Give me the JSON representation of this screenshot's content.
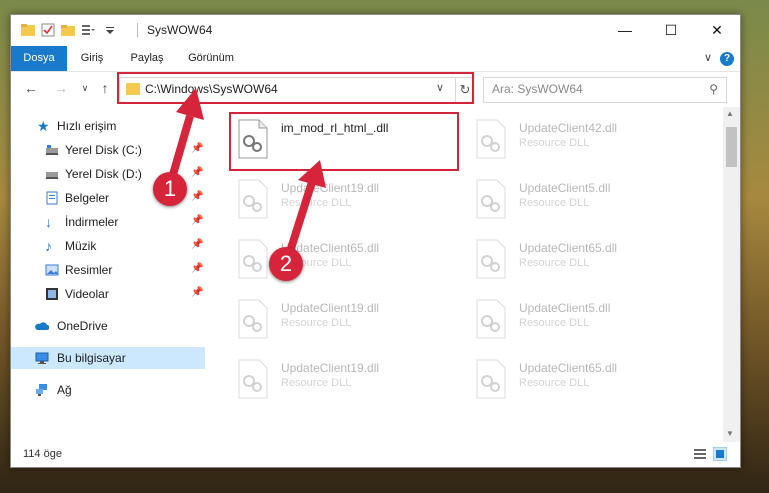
{
  "window": {
    "title": "SysWOW64"
  },
  "ribbon": {
    "tabs": [
      {
        "label": "Dosya",
        "active": true
      },
      {
        "label": "Giriş",
        "active": false
      },
      {
        "label": "Paylaş",
        "active": false
      },
      {
        "label": "Görünüm",
        "active": false
      }
    ],
    "help": "?"
  },
  "nav": {
    "address": "C:\\Windows\\SysWOW64",
    "search_placeholder": "Ara: SysWOW64"
  },
  "sidebar": {
    "items": [
      {
        "label": "Hızlı erişim",
        "icon": "star-icon",
        "pinned": false
      },
      {
        "label": "Yerel Disk (C:)",
        "icon": "drive-icon",
        "pinned": true
      },
      {
        "label": "Yerel Disk (D:)",
        "icon": "drive-icon",
        "pinned": true
      },
      {
        "label": "Belgeler",
        "icon": "documents-icon",
        "pinned": true
      },
      {
        "label": "İndirmeler",
        "icon": "download-icon",
        "pinned": true
      },
      {
        "label": "Müzik",
        "icon": "music-icon",
        "pinned": true
      },
      {
        "label": "Resimler",
        "icon": "pictures-icon",
        "pinned": true
      },
      {
        "label": "Videolar",
        "icon": "videos-icon",
        "pinned": true
      },
      {
        "label": "OneDrive",
        "icon": "cloud-icon",
        "pinned": false
      },
      {
        "label": "Bu bilgisayar",
        "icon": "computer-icon",
        "pinned": false,
        "selected": true
      },
      {
        "label": "Ağ",
        "icon": "network-icon",
        "pinned": false
      }
    ]
  },
  "files": [
    {
      "name": "im_mod_rl_html_.dll",
      "type": ""
    },
    {
      "name": "UpdateClient42.dll",
      "type": "Resource DLL"
    },
    {
      "name": "UpdateClient19.dll",
      "type": "Resource DLL"
    },
    {
      "name": "UpdateClient5.dll",
      "type": "Resource DLL"
    },
    {
      "name": "UpdateClient65.dll",
      "type": "Resource DLL"
    },
    {
      "name": "UpdateClient65.dll",
      "type": "Resource DLL"
    },
    {
      "name": "UpdateClient19.dll",
      "type": "Resource DLL"
    },
    {
      "name": "UpdateClient5.dll",
      "type": "Resource DLL"
    },
    {
      "name": "UpdateClient19.dll",
      "type": "Resource DLL"
    },
    {
      "name": "UpdateClient65.dll",
      "type": "Resource DLL"
    }
  ],
  "status": {
    "count": "114 öge"
  },
  "annotations": {
    "step1": "1",
    "step2": "2",
    "color": "#d6243a"
  },
  "colors": {
    "accent": "#1979ca",
    "selected": "#cce8ff"
  }
}
